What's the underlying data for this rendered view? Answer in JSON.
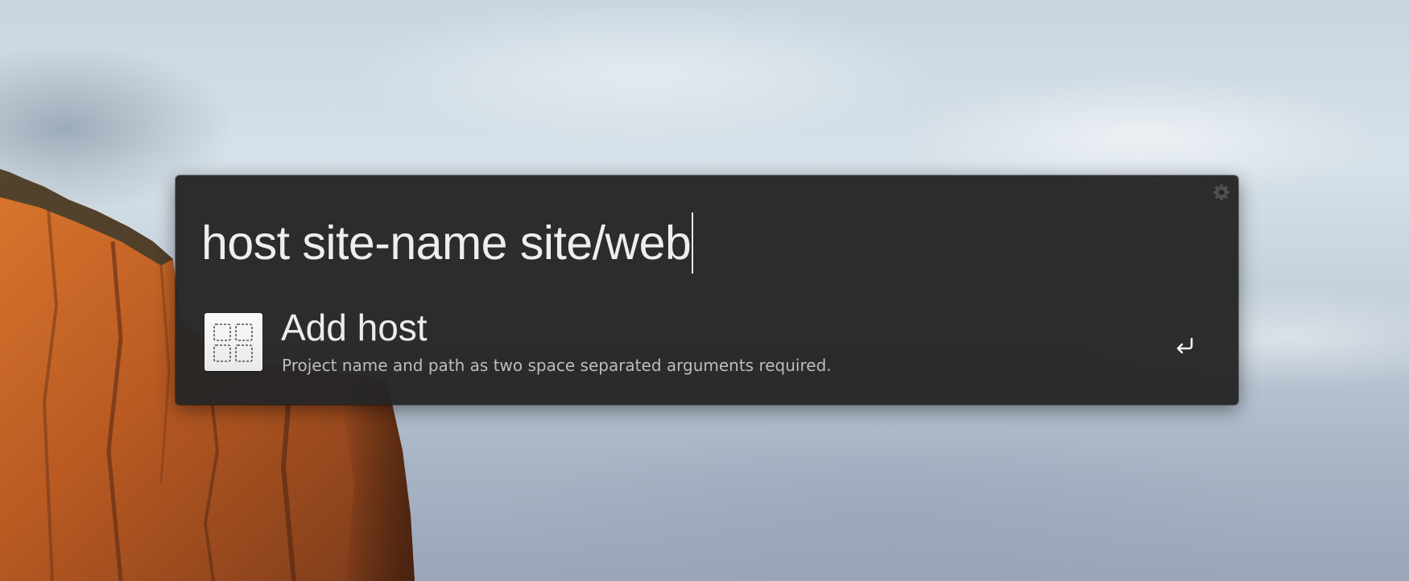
{
  "launcher": {
    "query": "host site-name site/web",
    "settings_icon": "gear-icon",
    "results": [
      {
        "title": "Add host",
        "subtitle": "Project name and path as two space separated arguments required.",
        "icon": "add-host-grid-icon",
        "action_icon": "return-key-icon"
      }
    ]
  },
  "colors": {
    "panel_background": "#262626",
    "query_text": "#eeeeee",
    "subtitle_text": "#bdbdbd"
  }
}
